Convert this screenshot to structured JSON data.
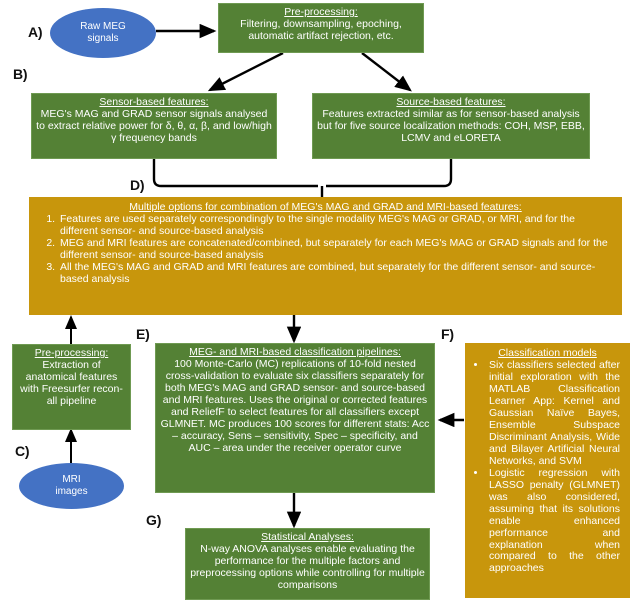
{
  "diagram": {
    "panels": {
      "a": "A)",
      "b": "B)",
      "c": "C)",
      "d": "D)",
      "e": "E)",
      "f": "F)",
      "g": "G)"
    },
    "colors": {
      "green": "#548135",
      "orange": "#c8960c",
      "blue": "#4472c4",
      "arrow": "#000000",
      "text": "#ffffff"
    },
    "nodes": {
      "raw_meg": {
        "label": "Raw MEG signals",
        "line1": "Raw MEG",
        "line2": "signals",
        "shape": "ellipse"
      },
      "mri_images": {
        "label": "MRI images",
        "line1": "MRI",
        "line2": "images",
        "shape": "ellipse"
      },
      "preprocessing_meg": {
        "title": "Pre-processing:",
        "body": "Filtering, downsampling, epoching, automatic artifact rejection, etc."
      },
      "preprocessing_mri": {
        "title": "Pre-processing:",
        "body": "Extraction of anatomical features with Freesurfer recon-all pipeline"
      },
      "sensor_features": {
        "title": "Sensor-based features:",
        "body": "MEG's MAG and GRAD sensor signals analysed to extract relative power for δ, θ, α, β, and low/high γ frequency bands"
      },
      "source_features": {
        "title": "Source-based features:",
        "body": "Features extracted similar as for sensor-based analysis but for five source localization methods: COH, MSP, EBB, LCMV and eLORETA"
      },
      "combination": {
        "title": "Multiple options for combination of MEG's MAG and GRAD and MRI-based features:",
        "items": [
          "Features are used separately correspondingly to the single modality MEG's MAG or GRAD, or MRI, and for the different sensor- and source-based analysis",
          "MEG and MRI features are concatenated/combined, but separately for each MEG's MAG or GRAD signals and for the different sensor- and source-based analysis",
          "All the MEG's MAG and GRAD and MRI features are combined, but separately for the different sensor- and source-based analysis"
        ]
      },
      "pipelines": {
        "title": "MEG- and MRI-based classification pipelines:",
        "body": "100 Monte-Carlo (MC) replications of 10-fold nested cross-validation to evaluate six classifiers separately for both MEG's MAG and GRAD sensor- and source-based and MRI features. Uses the original or corrected features and ReliefF to select features for all classifiers except GLMNET. MC produces 100 scores for different stats: Acc – accuracy, Sens – sensitivity, Spec – specificity, and AUC – area under the receiver operator curve"
      },
      "classification_models": {
        "title": "Classification models",
        "items": [
          "Six classifiers selected after initial exploration with the MATLAB Classification Learner App: Kernel and Gaussian Naïve Bayes, Ensemble Subspace Discriminant Analysis, Wide and Bilayer Artificial Neural Networks, and SVM",
          "Logistic regression with LASSO penalty (GLMNET) was also considered, assuming that its solutions enable enhanced performance and explanation when compared to the other approaches"
        ]
      },
      "statistical_analyses": {
        "title": "Statistical Analyses:",
        "body": "N-way ANOVA analyses enable evaluating the performance for the multiple factors and preprocessing options while controlling for multiple comparisons"
      }
    }
  }
}
